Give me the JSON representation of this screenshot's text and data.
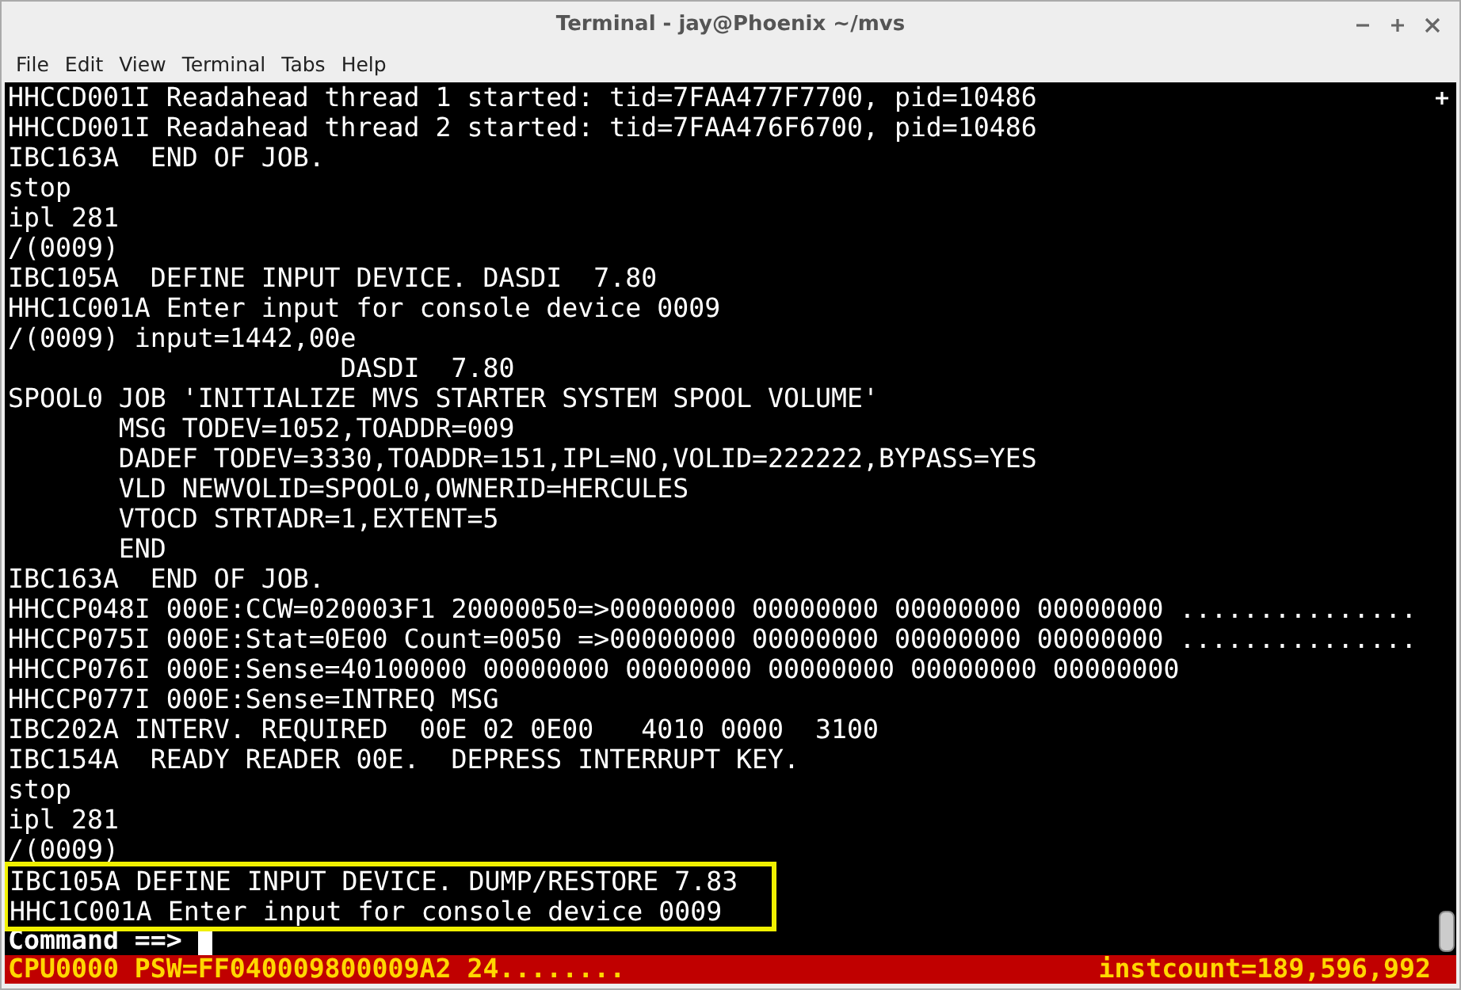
{
  "window": {
    "title": "Terminal - jay@Phoenix ~/mvs"
  },
  "menu": [
    "File",
    "Edit",
    "View",
    "Terminal",
    "Tabs",
    "Help"
  ],
  "terminal": {
    "lines": [
      "HHCCD001I Readahead thread 1 started: tid=7FAA477F7700, pid=10486",
      "HHCCD001I Readahead thread 2 started: tid=7FAA476F6700, pid=10486",
      "IBC163A  END OF JOB.",
      "stop",
      "ipl 281",
      "/(0009)",
      "IBC105A  DEFINE INPUT DEVICE. DASDI  7.80",
      "HHC1C001A Enter input for console device 0009",
      "/(0009) input=1442,00e",
      "                     DASDI  7.80",
      "SPOOL0 JOB 'INITIALIZE MVS STARTER SYSTEM SPOOL VOLUME'",
      "       MSG TODEV=1052,TOADDR=009",
      "       DADEF TODEV=3330,TOADDR=151,IPL=NO,VOLID=222222,BYPASS=YES",
      "       VLD NEWVOLID=SPOOL0,OWNERID=HERCULES",
      "       VTOCD STRTADR=1,EXTENT=5",
      "       END",
      "IBC163A  END OF JOB.",
      "HHCCP048I 000E:CCW=020003F1 20000050=>00000000 00000000 00000000 00000000 ...............",
      "HHCCP075I 000E:Stat=0E00 Count=0050 =>00000000 00000000 00000000 00000000 ...............",
      "HHCCP076I 000E:Sense=40100000 00000000 00000000 00000000 00000000 00000000",
      "HHCCP077I 000E:Sense=INTREQ MSG",
      "IBC202A INTERV. REQUIRED  00E 02 0E00   4010 0000  3100",
      "IBC154A  READY READER 00E.  DEPRESS INTERRUPT KEY.",
      "stop",
      "ipl 281",
      "/(0009)"
    ],
    "highlighted_lines": [
      "IBC105A DEFINE INPUT DEVICE. DUMP/RESTORE 7.83",
      "HHC1C001A Enter input for console device 0009"
    ],
    "prompt": "Command ==>"
  },
  "status_bar": {
    "left": "CPU0000 PSW=FF040009800009A2 24........",
    "right": "instcount=189,596,992"
  }
}
